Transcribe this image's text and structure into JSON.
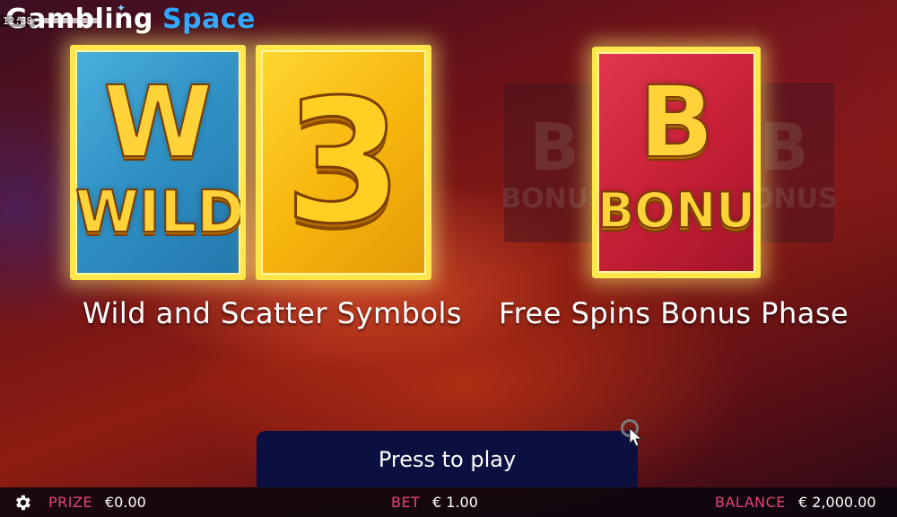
{
  "brand": {
    "part1": "Gambling",
    "part2": "Space"
  },
  "clock": {
    "time": "12:38"
  },
  "cards": {
    "wild": {
      "letter": "W",
      "word": "WILD"
    },
    "scatter": {
      "digit": "3"
    },
    "bonus": {
      "letter": "B",
      "word": "BONUS"
    },
    "ghost": {
      "letter": "B",
      "word": "BONUS"
    }
  },
  "captions": {
    "left": "Wild and Scatter Symbols",
    "right": "Free Spins Bonus Phase"
  },
  "play_button": {
    "label": "Press to play"
  },
  "bottom_bar": {
    "prize_label": "PRIZE",
    "prize_value": "€0.00",
    "bet_label": "BET",
    "bet_value": "€ 1.00",
    "balance_label": "BALANCE",
    "balance_value": "€ 2,000.00"
  },
  "colors": {
    "accent_blue": "#2fa6ff",
    "label_pink": "#e6427a",
    "button_navy": "#0c1040",
    "card_border_gold": "#ffe64a"
  },
  "icons": [
    "gear-icon",
    "cursor-icon"
  ]
}
